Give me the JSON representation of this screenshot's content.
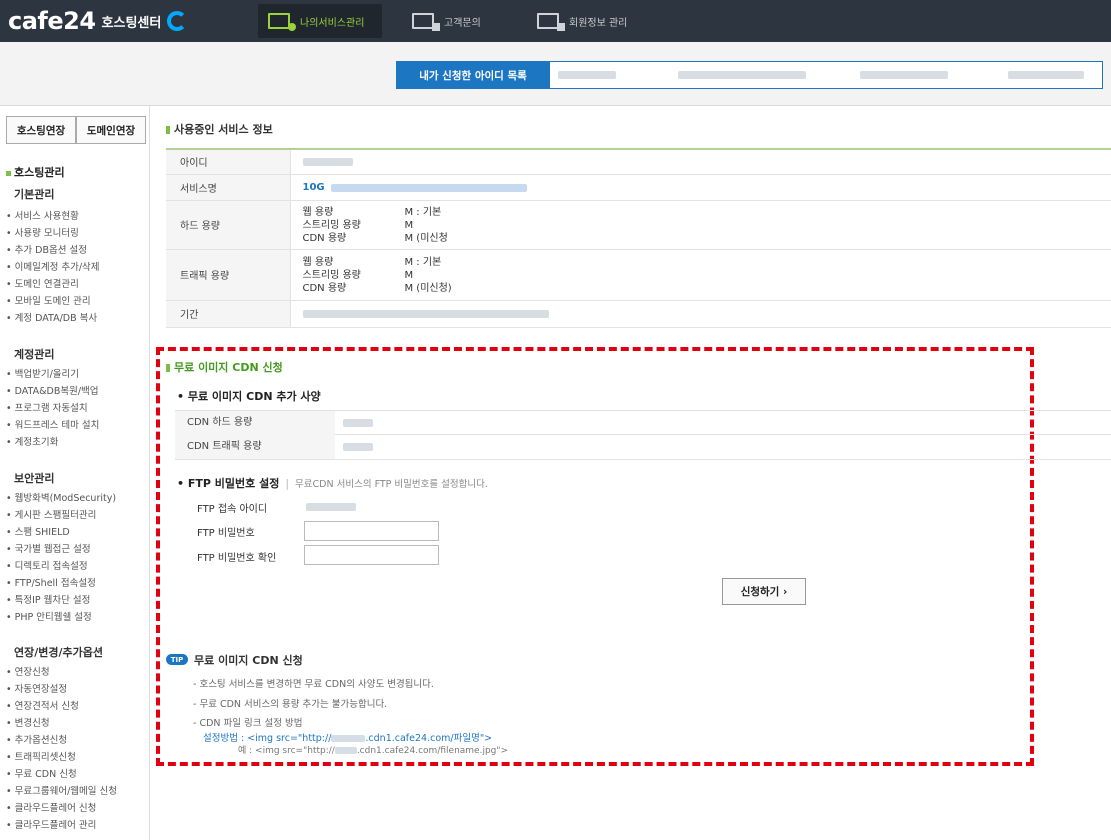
{
  "brand": {
    "logo": "cafe24",
    "sub": "호스팅센터"
  },
  "nav": [
    {
      "label": "나의서비스관리",
      "active": true
    },
    {
      "label": "고객문의",
      "active": false
    },
    {
      "label": "회원정보 관리",
      "active": false
    }
  ],
  "id_list_label": "내가 신청한 아이디 목록",
  "sidebar": {
    "btn_hosting": "호스팅연장",
    "btn_domain": "도메인연장",
    "title": "호스팅관리",
    "groups": [
      {
        "head": "기본관리",
        "items": [
          "• 서비스 사용현황",
          "• 사용량 모니터링",
          "• 추가 DB옵션 설정",
          "• 이메일계정 추가/삭제",
          "• 도메인 연결관리",
          "• 모바일 도메인 관리",
          "• 계정 DATA/DB 복사"
        ]
      },
      {
        "head": "계정관리",
        "items": [
          "• 백업받기/올리기",
          "• DATA&DB복원/백업",
          "• 프로그램 자동설치",
          "• 워드프레스 테마 설치",
          "• 계정초기화"
        ]
      },
      {
        "head": "보안관리",
        "items": [
          "• 웹방화벽(ModSecurity)",
          "• 게시판 스팸필터관리",
          "• 스팸 SHIELD",
          "• 국가별 웹접근 설정",
          "• 디렉토리 접속설정",
          "• FTP/Shell 접속설정",
          "• 특정IP 웹차단 설정",
          "• PHP 안티웹쉘 설정"
        ]
      },
      {
        "head": "연장/변경/추가옵션",
        "items": [
          "• 연장신청",
          "• 자동연장설정",
          "• 연장견적서 신청",
          "• 변경신청",
          "• 추가옵션신청",
          "• 트래픽리셋신청",
          "• 무료 CDN 신청",
          "• 무료그룹웨어/웹메일 신청",
          "• 클라우드플레어 신청",
          "• 클라우드플레어 관리"
        ]
      }
    ]
  },
  "service_info": {
    "title": "사용중인 서비스 정보",
    "labels": {
      "id": "아이디",
      "service": "서비스명",
      "disk": "하드 용량",
      "traffic": "트래픽 용량",
      "period": "기간"
    },
    "service_prefix": "10G",
    "disk": {
      "web": "웹 용량",
      "web_val": "M : 기본",
      "stream": "스트리밍 용량",
      "stream_val": "M",
      "cdn": "CDN 용량",
      "cdn_val": "M (미신청"
    },
    "traffic": {
      "web": "웹 용량",
      "web_val": "M : 기본",
      "stream": "스트리밍 용량",
      "stream_val": "M",
      "cdn": "CDN 용량",
      "cdn_val": "M (미신청)"
    }
  },
  "cdn": {
    "title": "무료 이미지 CDN 신청",
    "spec_title": "• 무료 이미지 CDN 추가 사양",
    "disk_label": "CDN 하드 용량",
    "traffic_label": "CDN 트래픽 용량",
    "ftp_title": "• FTP 비밀번호 설정",
    "ftp_desc": "무료CDN 서비스의 FTP 비밀번호를 설정합니다.",
    "ftp_id_label": "FTP 접속 아이디",
    "ftp_pw_label": "FTP 비밀번호",
    "ftp_pw_confirm_label": "FTP 비밀번호 확인",
    "apply_label": "신청하기 ›"
  },
  "tip": {
    "badge": "TIP",
    "title": "무료 이미지 CDN 신청",
    "lines": [
      "- 호스팅 서비스를 변경하면 무료 CDN의 사양도 변경됩니다.",
      "- 무료 CDN 서비스의 용량 추가는 불가능합니다.",
      "- CDN 파일 링크 설정 방법"
    ],
    "method_prefix": "설정방법 : <img src=\"http://",
    "method_suffix": ".cdn1.cafe24.com/파일명\">",
    "example_prefix": "예 : <img src=\"http://",
    "example_suffix": ".cdn1.cafe24.com/filename.jpg\">"
  },
  "colors": {
    "topbar": "#2c3540",
    "accent_green": "#9bd23c",
    "accent_blue": "#1c76c2",
    "dash_red": "#e20010"
  }
}
